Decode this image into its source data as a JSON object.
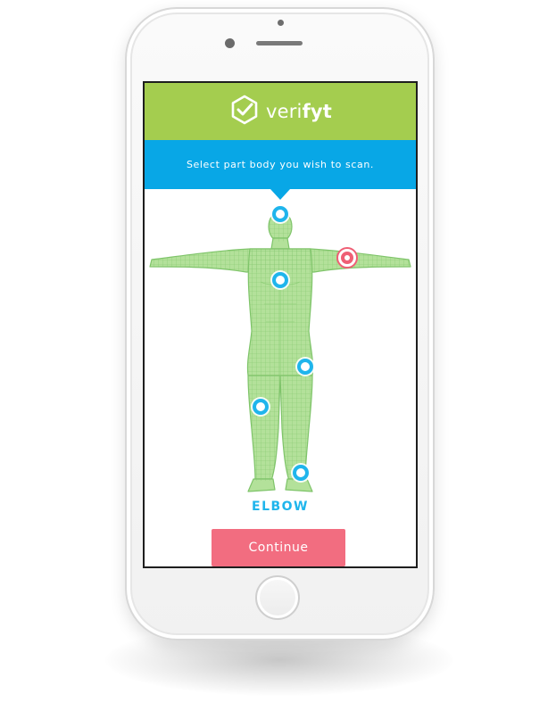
{
  "app": {
    "brand_prefix": "veri",
    "brand_suffix": "fyt"
  },
  "instruction": {
    "text": "Select part body you wish to scan."
  },
  "selection": {
    "label": "ELBOW"
  },
  "actions": {
    "continue_label": "Continue"
  },
  "markers": {
    "head": "head-marker",
    "chest": "chest-marker",
    "elbow": "elbow-marker",
    "knee": "knee-marker",
    "hand": "hand-marker",
    "ankle": "ankle-marker"
  },
  "colors": {
    "header_green": "#a4cd4f",
    "instruction_blue": "#08a7e6",
    "marker_blue": "#1fb5ec",
    "selected_red": "#ef5f75",
    "button_pink": "#f26d80",
    "body_green": "#a9dc8f"
  }
}
